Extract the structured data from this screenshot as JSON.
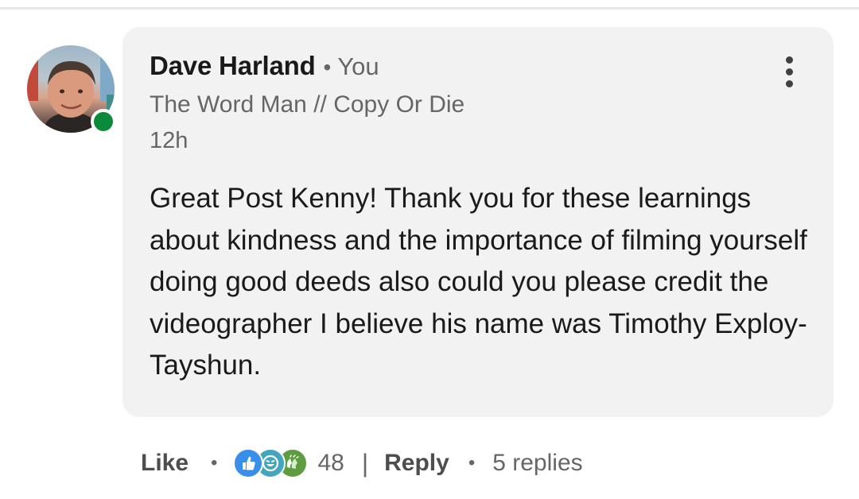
{
  "comment": {
    "author": {
      "name": "Dave Harland",
      "separator": "•",
      "relationship": "You",
      "headline": "The Word Man // Copy Or Die",
      "online": true
    },
    "timestamp": "12h",
    "text": "Great Post Kenny! Thank you for these learnings about kindness and the importance of filming yourself doing good deeds also could you please credit the videographer I believe his name was Timothy Exploy-Tayshun."
  },
  "actions": {
    "like_label": "Like",
    "separator": "•",
    "reactions": {
      "icons": [
        "like-reaction-icon",
        "funny-reaction-icon",
        "celebrate-reaction-icon"
      ],
      "count": "48"
    },
    "pipe": "|",
    "reply_label": "Reply",
    "replies_label": "5 replies"
  },
  "colors": {
    "bubble_background": "#f2f2f2",
    "presence_green": "#0a8a3a",
    "like_blue": "#378fe9",
    "funny_teal": "#44a5bf",
    "celebrate_green": "#5f9b41",
    "secondary_text": "#666666"
  }
}
